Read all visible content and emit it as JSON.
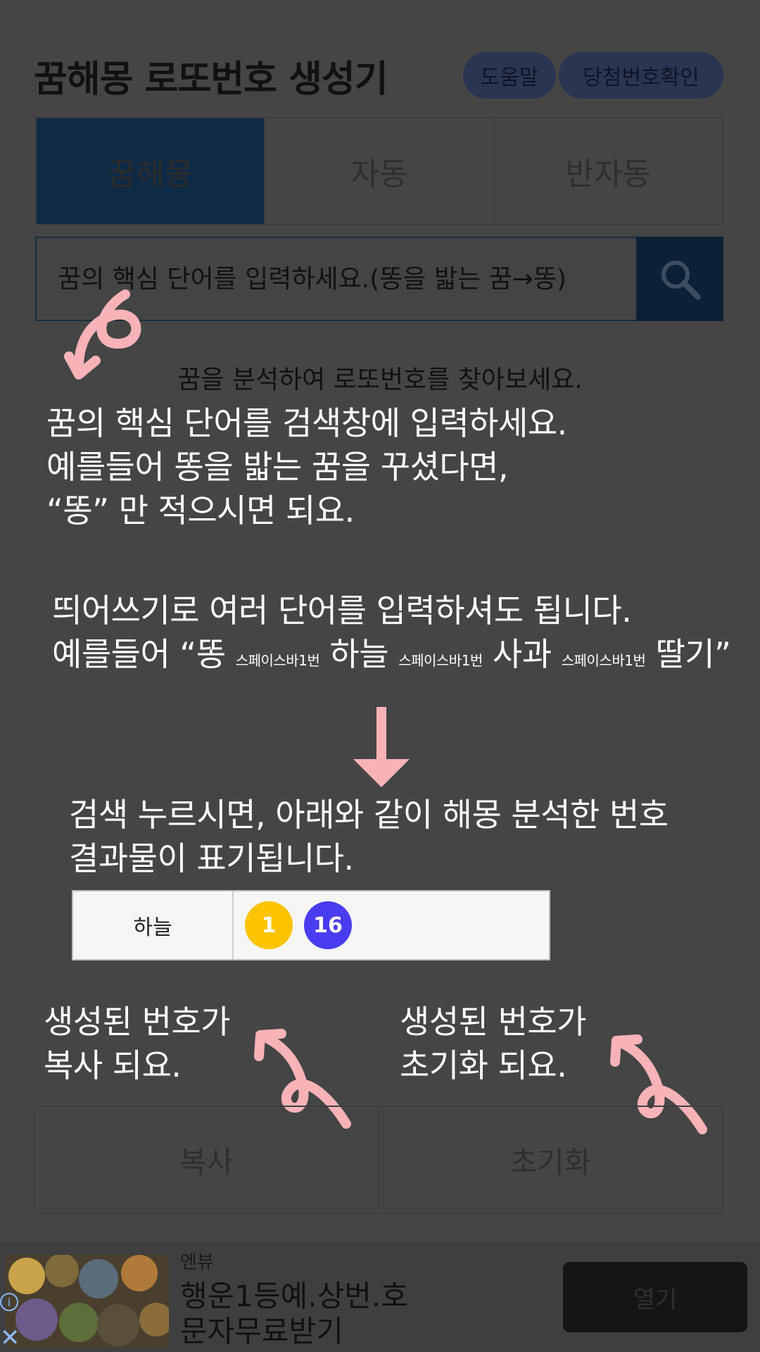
{
  "header": {
    "title": "꿈해몽 로또번호 생성기",
    "help_label": "도움말",
    "check_label": "당첨번호확인"
  },
  "tabs": [
    {
      "label": "꿈해몽",
      "active": true
    },
    {
      "label": "자동",
      "active": false
    },
    {
      "label": "반자동",
      "active": false
    }
  ],
  "search": {
    "placeholder": "꿈의 핵심 단어를 입력하세요.(똥을 밟는 꿈→똥)",
    "icon": "search-icon"
  },
  "page": {
    "description": "꿈을 분석하여 로또번호를 찾아보세요."
  },
  "guide": {
    "line1": "꿈의 핵심 단어를 검색창에 입력하세요.",
    "line2": "예를들어 똥을 밟는 꿈을 꾸셨다면,",
    "line3": "“똥” 만 적으시면 되요.",
    "line4": "띄어쓰기로 여러 단어를 입력하셔도 됩니다.",
    "line5_prefix": "예를들어 “똥",
    "spacebar": "스페이스바1번",
    "word2": "하늘",
    "word3": "사과",
    "word4_suffix": "딸기”",
    "line6": "검색 누르시면, 아래와 같이 해몽 분석한 번호",
    "line7": "결과물이 표기됩니다.",
    "copy_note_1": "생성된 번호가",
    "copy_note_2": "복사 되요.",
    "reset_note_1": "생성된 번호가",
    "reset_note_2": "초기화 되요."
  },
  "example_result": {
    "word": "하늘",
    "numbers": [
      "1",
      "16"
    ],
    "ball_colors": [
      "#fcc400",
      "#4a3cf0"
    ]
  },
  "buttons": {
    "copy_label": "복사",
    "reset_label": "초기화"
  },
  "ad": {
    "advertiser": "엔뷰",
    "title_line1": "행운1등예.상번.호",
    "title_line2": "문자무료받기",
    "open_label": "열기"
  },
  "colors": {
    "overlay_bg": "#454545",
    "arrow": "#f7b3b8",
    "tab_active": "#0f2a45",
    "pill": "#2a3552"
  }
}
